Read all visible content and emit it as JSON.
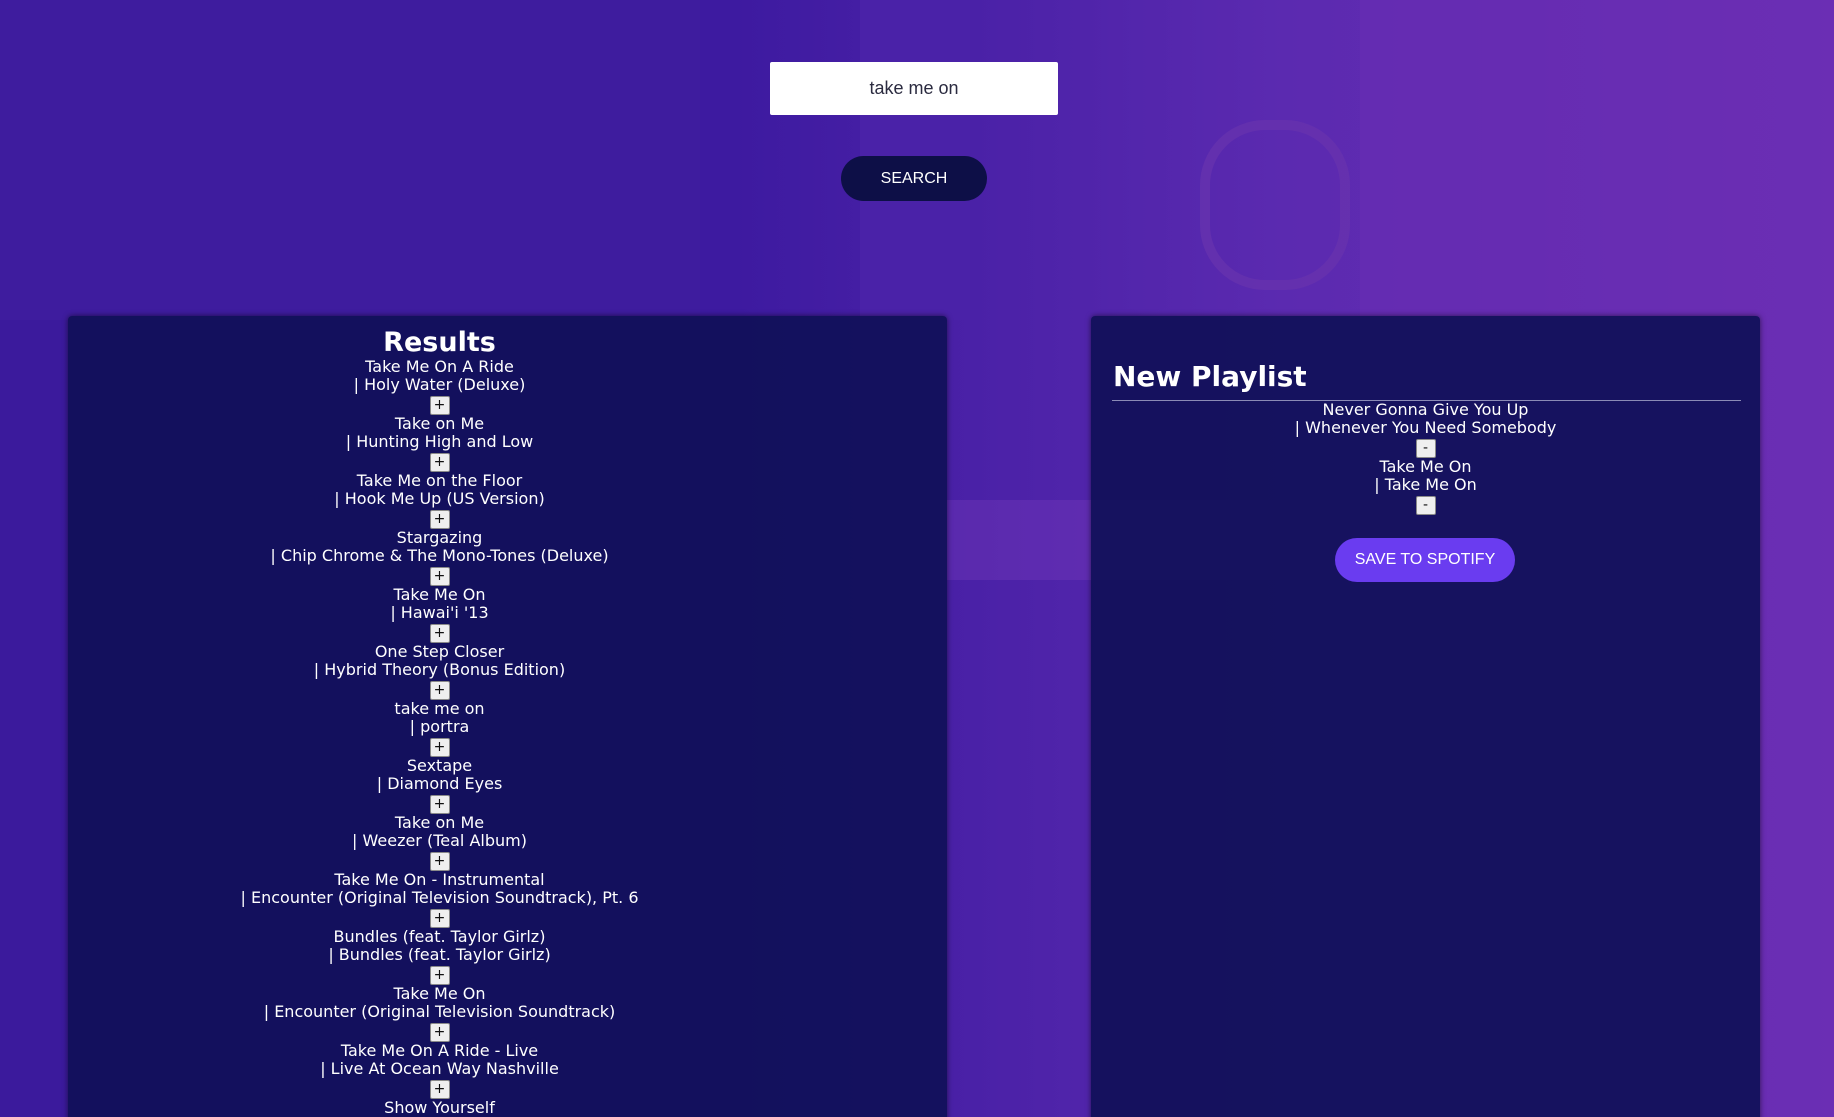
{
  "search": {
    "value": "take me on",
    "button_label": "SEARCH"
  },
  "results": {
    "title": "Results",
    "add_label": "+",
    "tracks": [
      {
        "name": "Take Me On A Ride",
        "album": "| Holy Water (Deluxe)"
      },
      {
        "name": "Take on Me",
        "album": "| Hunting High and Low"
      },
      {
        "name": "Take Me on the Floor",
        "album": "| Hook Me Up (US Version)"
      },
      {
        "name": "Stargazing",
        "album": "| Chip Chrome & The Mono-Tones (Deluxe)"
      },
      {
        "name": "Take Me On",
        "album": "| Hawai'i '13"
      },
      {
        "name": "One Step Closer",
        "album": "| Hybrid Theory (Bonus Edition)"
      },
      {
        "name": "take me on",
        "album": "| portra"
      },
      {
        "name": "Sextape",
        "album": "| Diamond Eyes"
      },
      {
        "name": "Take on Me",
        "album": "| Weezer (Teal Album)"
      },
      {
        "name": "Take Me On - Instrumental",
        "album": "| Encounter (Original Television Soundtrack), Pt. 6"
      },
      {
        "name": "Bundles (feat. Taylor Girlz)",
        "album": "| Bundles (feat. Taylor Girlz)"
      },
      {
        "name": "Take Me On",
        "album": "| Encounter (Original Television Soundtrack)"
      },
      {
        "name": "Take Me On A Ride - Live",
        "album": "| Live At Ocean Way Nashville"
      },
      {
        "name": "Show Yourself",
        "album": ""
      }
    ]
  },
  "playlist": {
    "title": "New Playlist",
    "remove_label": "-",
    "tracks": [
      {
        "name": "Never Gonna Give You Up",
        "album": "| Whenever You Need Somebody"
      },
      {
        "name": "Take Me On",
        "album": "| Take Me On"
      }
    ],
    "save_label": "SAVE TO SPOTIFY"
  },
  "colors": {
    "background": "#3b1a9c",
    "panel": "#101058",
    "search_button": "#0d0f47",
    "save_button": "#6a3cf0"
  }
}
